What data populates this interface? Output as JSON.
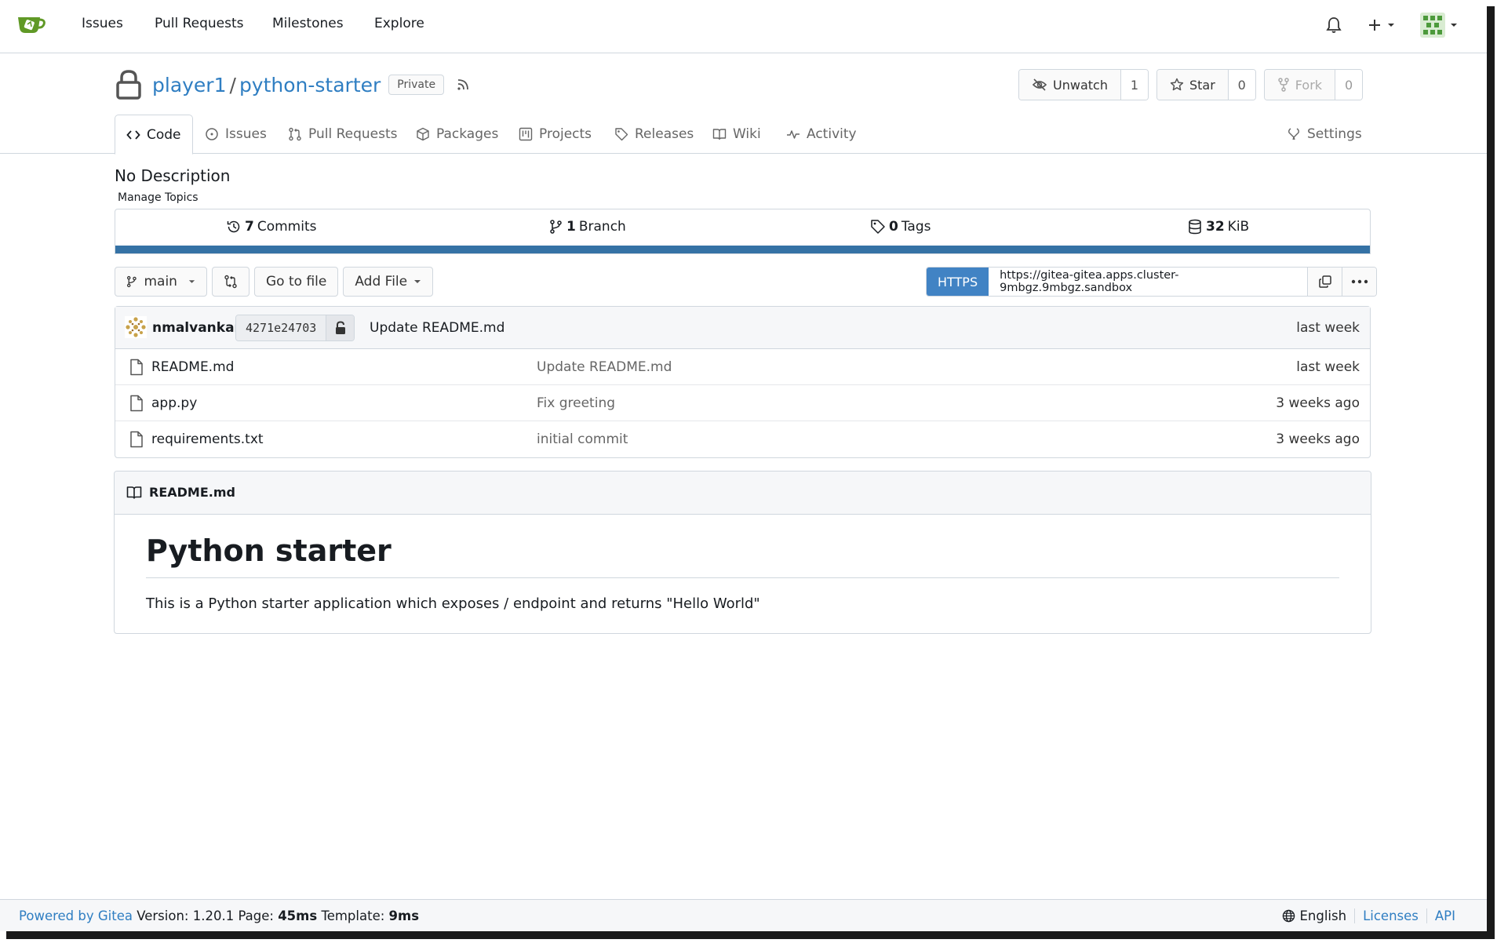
{
  "navbar": {
    "items": [
      "Issues",
      "Pull Requests",
      "Milestones",
      "Explore"
    ]
  },
  "repo": {
    "owner": "player1",
    "separator": "/",
    "name": "python-starter",
    "visibility": "Private",
    "watch_label": "Unwatch",
    "watch_count": "1",
    "star_label": "Star",
    "star_count": "0",
    "fork_label": "Fork",
    "fork_count": "0"
  },
  "tabs": [
    {
      "label": "Code",
      "icon": "code-icon",
      "active": true
    },
    {
      "label": "Issues",
      "icon": "issue-icon"
    },
    {
      "label": "Pull Requests",
      "icon": "pull-request-icon"
    },
    {
      "label": "Packages",
      "icon": "package-icon"
    },
    {
      "label": "Projects",
      "icon": "project-icon"
    },
    {
      "label": "Releases",
      "icon": "tag-icon"
    },
    {
      "label": "Wiki",
      "icon": "book-icon"
    },
    {
      "label": "Activity",
      "icon": "pulse-icon"
    },
    {
      "label": "Settings",
      "icon": "tools-icon"
    }
  ],
  "description": "No Description",
  "manage_topics": "Manage Topics",
  "stats": {
    "commits_count": "7",
    "commits_label": "Commits",
    "branch_count": "1",
    "branch_label": "Branch",
    "tags_count": "0",
    "tags_label": "Tags",
    "size_value": "32",
    "size_unit": "KiB",
    "language_color": "#3572a5"
  },
  "toolbar": {
    "branch": "main",
    "go_to_file": "Go to file",
    "add_file": "Add File"
  },
  "clone": {
    "protocol": "HTTPS",
    "url": "https://gitea-gitea.apps.cluster-9mbgz.9mbgz.sandbox"
  },
  "latest_commit": {
    "author": "nmalvankar",
    "sha": "4271e24703",
    "message": "Update README.md",
    "time": "last week"
  },
  "files": [
    {
      "name": "README.md",
      "message": "Update README.md",
      "time": "last week"
    },
    {
      "name": "app.py",
      "message": "Fix greeting",
      "time": "3 weeks ago"
    },
    {
      "name": "requirements.txt",
      "message": "initial commit",
      "time": "3 weeks ago"
    }
  ],
  "readme": {
    "filename": "README.md",
    "heading": "Python starter",
    "paragraph": "This is a Python starter application which exposes / endpoint and returns \"Hello World\""
  },
  "footer": {
    "powered_by": "Powered by Gitea",
    "version_label": "Version: 1.20.1 Page:",
    "page_time": "45ms",
    "template_label": "Template:",
    "template_time": "9ms",
    "language": "English",
    "licenses": "Licenses",
    "api": "API"
  },
  "colors": {
    "accent": "#4183c4",
    "link": "#2f7ec2",
    "brand": "#609926"
  }
}
